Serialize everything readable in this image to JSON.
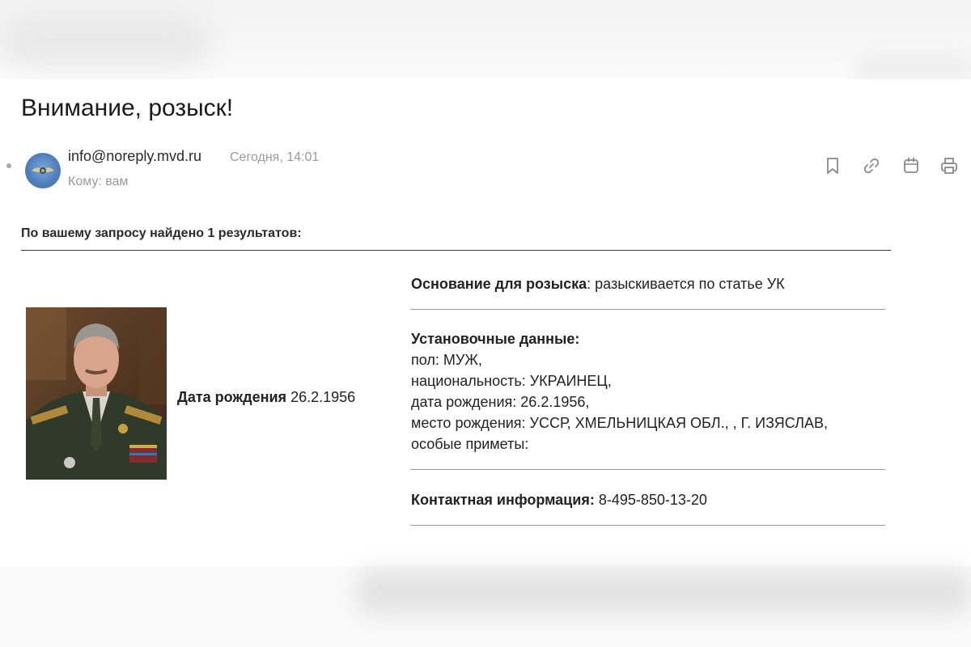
{
  "email": {
    "subject": "Внимание, розыск!",
    "sender": "info@noreply.mvd.ru",
    "date": "Сегодня, 14:01",
    "recipient": "Кому: вам",
    "actions": [
      {
        "name": "bookmark-icon"
      },
      {
        "name": "link-icon"
      },
      {
        "name": "calendar-icon"
      },
      {
        "name": "print-icon"
      }
    ]
  },
  "result": {
    "query_text": "По вашему запросу найдено 1 результатов:",
    "dob_label": "Дата рождения",
    "dob_value": "26.2.1956",
    "basis_label": "Основание для розыска",
    "basis_value": ": разыскивается по статье УК",
    "details_label": "Установочные данные:",
    "details_lines": [
      "пол: МУЖ,",
      "национальность: УКРАИНЕЦ,",
      "дата рождения: 26.2.1956,",
      "место рождения: УССР, ХМЕЛЬНИЦКАЯ ОБЛ., , Г. ИЗЯСЛАВ,",
      "особые приметы:"
    ],
    "contact_label": "Контактная информация:",
    "contact_value": "8-495-850-13-20"
  },
  "colors": {
    "text": "#1f1f1f",
    "muted": "#9a9a9a",
    "icon": "#8a8a8a",
    "avatar": "#4f80bd"
  }
}
